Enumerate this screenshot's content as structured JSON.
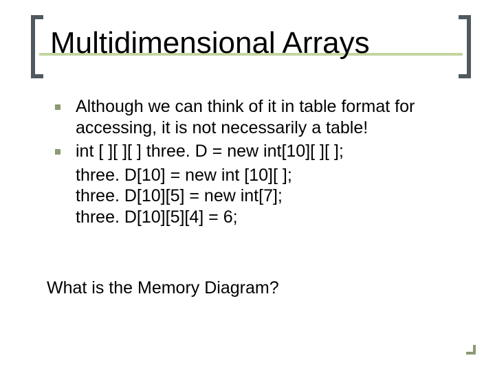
{
  "title": "Multidimensional Arrays",
  "bullets": [
    {
      "text": "Although we can think of it in table format for accessing, it is not necessarily a table!",
      "sublines": []
    },
    {
      "text": "int [ ][ ][ ] three. D = new int[10][ ][ ];",
      "sublines": [
        "three. D[10] = new int [10][ ];",
        "three. D[10][5] = new int[7];",
        "three. D[10][5][4] = 6;"
      ]
    }
  ],
  "footer_question": "What is the Memory Diagram?"
}
